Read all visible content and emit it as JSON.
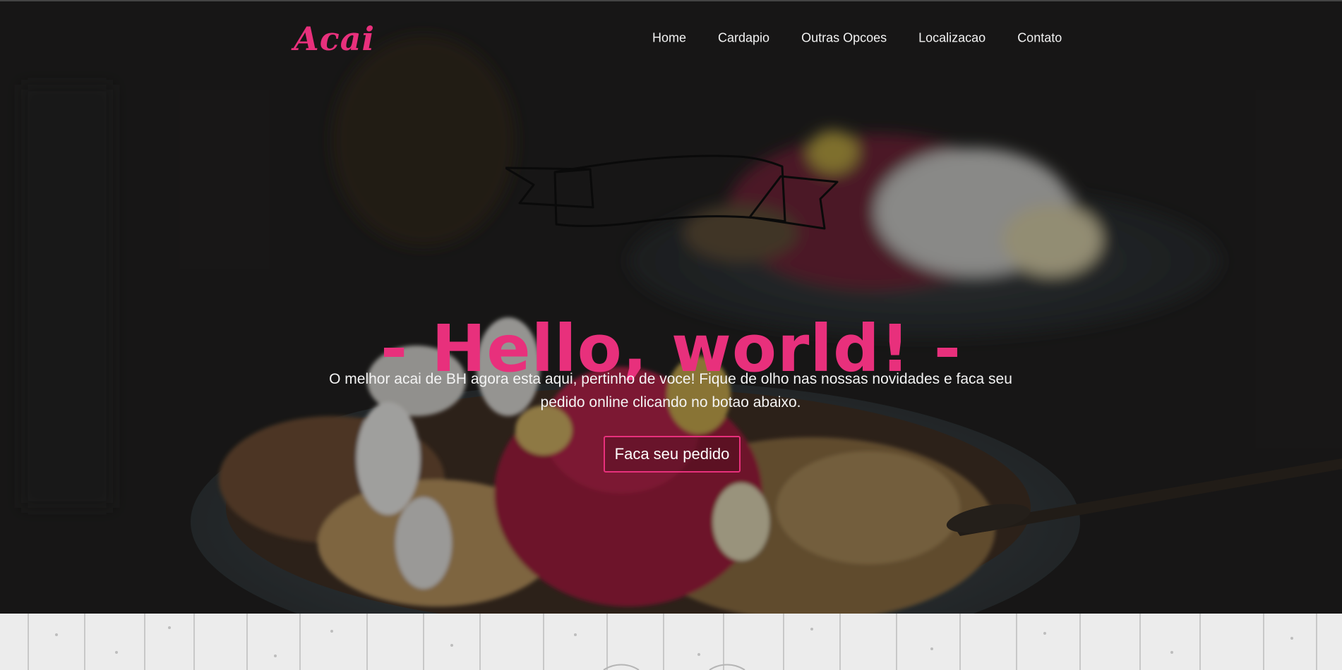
{
  "header": {
    "logo": "Acai",
    "nav": [
      "Home",
      "Cardapio",
      "Outras Opcoes",
      "Localizacao",
      "Contato"
    ]
  },
  "hero": {
    "title": "- Hello, world! -",
    "text": "O melhor acai de BH agora esta aqui, pertinho de voce! Fique de olho nas nossas novidades e faca seu pedido online clicando no botao abaixo.",
    "cta": "Faca seu pedido"
  },
  "colors": {
    "accent": "#e8307c",
    "text_light": "#f4f4f4",
    "overlay": "#1a1a1a",
    "wood": "#e9e9e9"
  }
}
